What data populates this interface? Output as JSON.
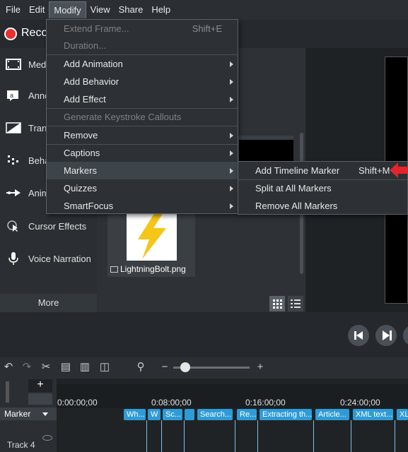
{
  "menubar": {
    "items": [
      {
        "label": "File"
      },
      {
        "label": "Edit"
      },
      {
        "label": "Modify"
      },
      {
        "label": "View"
      },
      {
        "label": "Share"
      },
      {
        "label": "Help"
      }
    ]
  },
  "record": {
    "label": "Reco"
  },
  "tools": {
    "items": [
      {
        "label": "Medi",
        "icon": "media-icon"
      },
      {
        "label": "Anno",
        "icon": "annotations-icon"
      },
      {
        "label": "Trans",
        "icon": "transitions-icon"
      },
      {
        "label": "Beha",
        "icon": "behaviors-icon"
      },
      {
        "label": "Anim",
        "icon": "animations-icon"
      },
      {
        "label": "Cursor Effects",
        "icon": "cursor-effects-icon"
      },
      {
        "label": "Voice Narration",
        "icon": "microphone-icon"
      }
    ],
    "more_label": "More",
    "plus_label": "+"
  },
  "bin": {
    "file_label": "LightningBolt.png"
  },
  "modify_menu": {
    "items": [
      {
        "label": "Extend Frame...",
        "shortcut": "Shift+E",
        "disabled": true
      },
      {
        "label": "Duration...",
        "disabled": true
      },
      {
        "label": "Add Animation",
        "submenu": true
      },
      {
        "label": "Add Behavior",
        "submenu": true
      },
      {
        "label": "Add Effect",
        "submenu": true
      },
      {
        "label": "Generate Keystroke Callouts",
        "disabled": true
      },
      {
        "label": "Remove",
        "submenu": true
      },
      {
        "label": "Captions",
        "submenu": true
      },
      {
        "label": "Markers",
        "submenu": true,
        "highlighted": true
      },
      {
        "label": "Quizzes",
        "submenu": true
      },
      {
        "label": "SmartFocus",
        "submenu": true
      }
    ]
  },
  "markers_submenu": {
    "items": [
      {
        "label": "Add Timeline Marker",
        "shortcut": "Shift+M"
      },
      {
        "label": "Split at All Markers"
      },
      {
        "label": "Remove All Markers"
      }
    ]
  },
  "timeline": {
    "ruler": [
      "0:00:00;00",
      "0:08:00;00",
      "0:16:00;00",
      "0:24:00;00"
    ],
    "marker_label": "Marker",
    "track_label": "Track 4",
    "markers": [
      "Wh...",
      "W",
      "Sc...",
      "",
      "Search...",
      "Re...",
      "Extracting th...",
      "Article...",
      "XML text...",
      "XL"
    ]
  },
  "colors": {
    "record": "#e8312f",
    "marker": "#2e9bd6",
    "accent_arrow": "#e5232b",
    "lightning": "#f5c518"
  }
}
